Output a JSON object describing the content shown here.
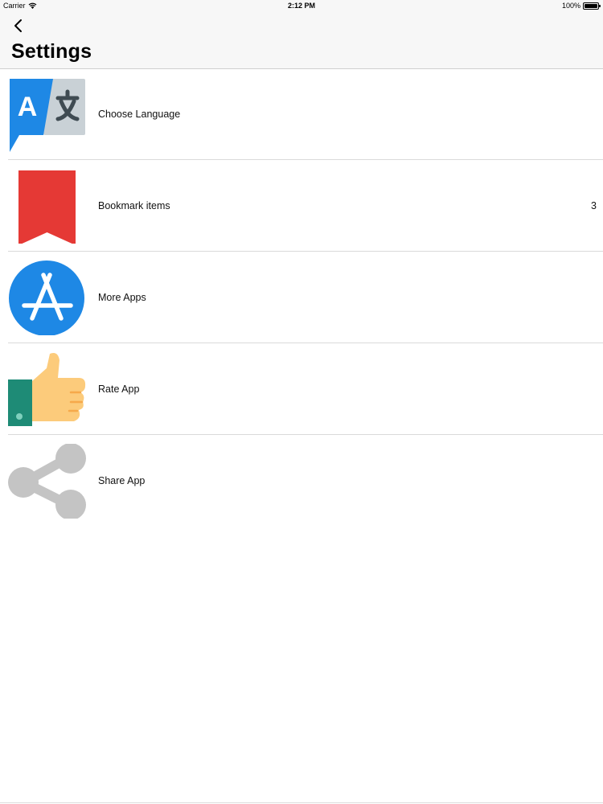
{
  "status_bar": {
    "carrier": "Carrier",
    "time": "2:12 PM",
    "battery": "100%"
  },
  "nav": {
    "title": "Settings"
  },
  "rows": [
    {
      "label": "Choose Language",
      "icon": "translate-icon",
      "detail": ""
    },
    {
      "label": "Bookmark items",
      "icon": "bookmark-icon",
      "detail": "3"
    },
    {
      "label": "More Apps",
      "icon": "app-store-icon",
      "detail": ""
    },
    {
      "label": "Rate App",
      "icon": "thumbs-up-icon",
      "detail": ""
    },
    {
      "label": "Share App",
      "icon": "share-icon",
      "detail": ""
    }
  ],
  "colors": {
    "translate_blue": "#1e88e5",
    "translate_gray": "#c9d1d6",
    "bookmark_red": "#e53935",
    "appstore_blue": "#1e88e5",
    "thumb_skin": "#fccb7b",
    "thumb_cuff": "#1e8b76",
    "share_gray": "#c4c4c4"
  }
}
